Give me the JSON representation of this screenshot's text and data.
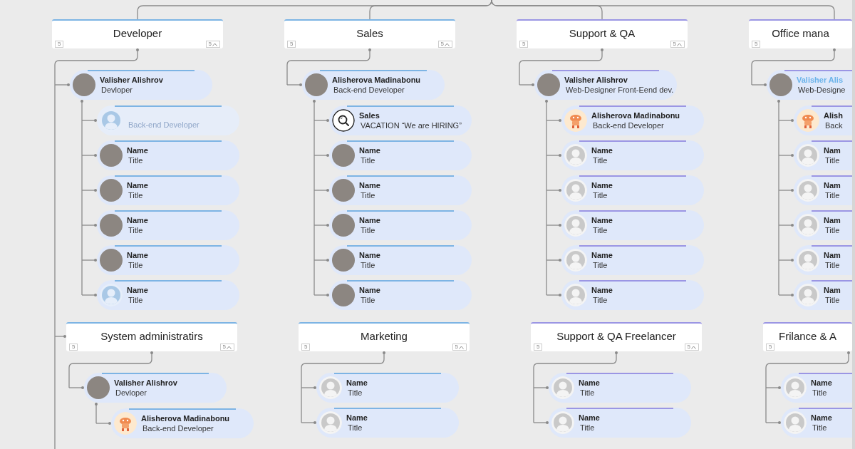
{
  "department_rows": [
    {
      "departments": [
        {
          "title": "Developer",
          "color": "#7db4e4",
          "count": "5",
          "collapse_count": "5",
          "manager": {
            "name": "Valisher Alishrov",
            "title": "Devloper",
            "kind": "photo",
            "highlighted": false
          },
          "members": [
            {
              "title": "Back-end Developer",
              "kind": "blue-silhouette",
              "faded": true
            },
            {
              "name": "Name",
              "title": "Title",
              "kind": "photo",
              "faded": false
            },
            {
              "name": "Name",
              "title": "Title",
              "kind": "photo",
              "faded": false
            },
            {
              "name": "Name",
              "title": "Title",
              "kind": "photo",
              "faded": false
            },
            {
              "name": "Name",
              "title": "Title",
              "kind": "photo",
              "faded": false
            },
            {
              "name": "Name",
              "title": "Title",
              "kind": "blue-silhouette",
              "faded": false
            }
          ]
        },
        {
          "title": "Sales",
          "color": "#7db4e4",
          "count": "5",
          "collapse_count": "5",
          "manager": {
            "name": "Alisherova Madinabonu",
            "title": "Back-end Developer",
            "kind": "photo",
            "highlighted": false
          },
          "members": [
            {
              "name": "Sales",
              "title": "VACATION “We are HIRING”",
              "kind": "search",
              "faded": false
            },
            {
              "name": "Name",
              "title": "Title",
              "kind": "photo",
              "faded": false
            },
            {
              "name": "Name",
              "title": "Title",
              "kind": "photo",
              "faded": false
            },
            {
              "name": "Name",
              "title": "Title",
              "kind": "photo",
              "faded": false
            },
            {
              "name": "Name",
              "title": "Title",
              "kind": "photo",
              "faded": false
            },
            {
              "name": "Name",
              "title": "Title",
              "kind": "photo",
              "faded": false
            }
          ]
        },
        {
          "title": "Support & QA",
          "color": "#9b96e4",
          "count": "5",
          "collapse_count": "5",
          "manager": {
            "name": "Valisher Alishrov",
            "title": "Web-Designer Front-Eend dev.",
            "kind": "photo",
            "highlighted": false
          },
          "members": [
            {
              "name": "Alisherova Madinabonu",
              "title": "Back-end Developer",
              "kind": "mascot",
              "faded": false
            },
            {
              "name": "Name",
              "title": "Title",
              "kind": "silhouette",
              "faded": false
            },
            {
              "name": "Name",
              "title": "Title",
              "kind": "silhouette",
              "faded": false
            },
            {
              "name": "Name",
              "title": "Title",
              "kind": "silhouette",
              "faded": false
            },
            {
              "name": "Name",
              "title": "Title",
              "kind": "silhouette",
              "faded": false
            },
            {
              "name": "Name",
              "title": "Title",
              "kind": "silhouette",
              "faded": false
            }
          ]
        },
        {
          "title": "Office mana",
          "color": "#9b96e4",
          "count": "5",
          "manager": {
            "name": "Valisher Alis",
            "title": "Web-Designe",
            "kind": "photo",
            "highlighted": true
          },
          "members": [
            {
              "name": "Alish",
              "title": "Back",
              "kind": "mascot",
              "faded": false
            },
            {
              "name": "Nam",
              "title": "Title",
              "kind": "silhouette",
              "faded": false
            },
            {
              "name": "Nam",
              "title": "Title",
              "kind": "silhouette",
              "faded": false
            },
            {
              "name": "Nam",
              "title": "Title",
              "kind": "silhouette",
              "faded": false
            },
            {
              "name": "Nam",
              "title": "Title",
              "kind": "silhouette",
              "faded": false
            },
            {
              "name": "Nam",
              "title": "Title",
              "kind": "silhouette",
              "faded": false
            }
          ]
        }
      ]
    },
    {
      "departments": [
        {
          "title": "System administratirs",
          "color": "#7db4e4",
          "count": "5",
          "collapse_count": "5",
          "manager": {
            "name": "Valisher Alishrov",
            "title": "Devloper",
            "kind": "photo",
            "highlighted": false
          },
          "members": [
            {
              "name": "Alisherova Madinabonu",
              "title": "Back-end Developer",
              "kind": "mascot",
              "faded": false
            }
          ]
        },
        {
          "title": "Marketing",
          "color": "#7db4e4",
          "count": "5",
          "collapse_count": "5",
          "members": [
            {
              "name": "Name",
              "title": "Title",
              "kind": "silhouette",
              "faded": false
            },
            {
              "name": "Name",
              "title": "Title",
              "kind": "silhouette",
              "faded": false
            }
          ]
        },
        {
          "title": "Support & QA Freelancer",
          "color": "#9b96e4",
          "count": "5",
          "collapse_count": "5",
          "members": [
            {
              "name": "Name",
              "title": "Title",
              "kind": "silhouette",
              "faded": false
            },
            {
              "name": "Name",
              "title": "Title",
              "kind": "silhouette",
              "faded": false
            }
          ]
        },
        {
          "title": "Frilance & A",
          "color": "#9b96e4",
          "count": "5",
          "members": [
            {
              "name": "Name",
              "title": "Title",
              "kind": "silhouette",
              "faded": false
            },
            {
              "name": "Name",
              "title": "Title",
              "kind": "silhouette",
              "faded": false
            }
          ]
        }
      ]
    }
  ]
}
